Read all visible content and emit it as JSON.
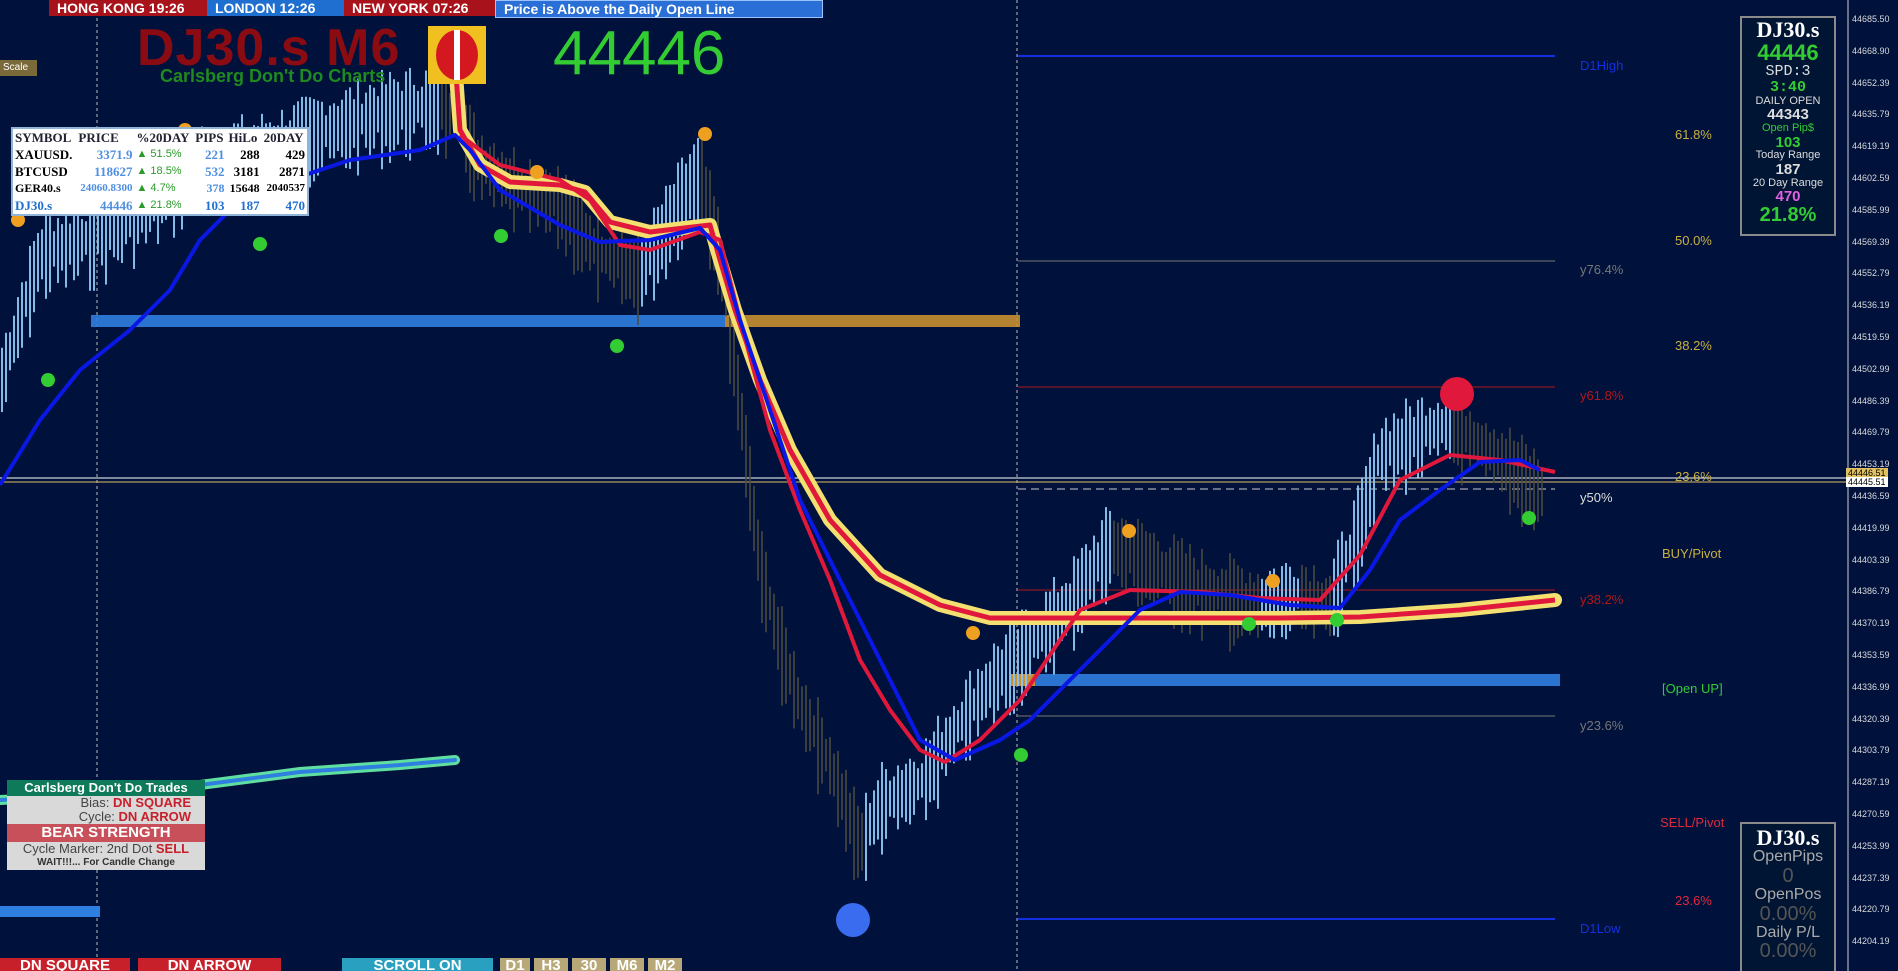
{
  "session_clocks": {
    "hong_kong": "HONG KONG 19:26",
    "london": "LONDON  12:26",
    "new_york": "NEW YORK 07:26"
  },
  "status_message": "Price is Above the Daily Open Line",
  "scale_button": "Scale",
  "header": {
    "title": "DJ30.s M6",
    "subtitle": "Carlsberg Don't Do Charts",
    "price": "44446"
  },
  "symbol_table": {
    "headers": [
      "SYMBOL",
      "PRICE",
      "%20DAY",
      "PIPS",
      "HiLo",
      "20DAY"
    ],
    "rows": [
      {
        "symbol": "XAUUSD.",
        "price": "3371.9",
        "pct": "▲ 51.5%",
        "pips": "221",
        "hilo": "288",
        "day20": "429"
      },
      {
        "symbol": "BTCUSD",
        "price": "118627",
        "pct": "▲ 18.5%",
        "pips": "532",
        "hilo": "3181",
        "day20": "2871"
      },
      {
        "symbol": "GER40.s",
        "price": "24060.8300",
        "pct": "▲ 4.7%",
        "pips": "378",
        "hilo": "15648",
        "day20": "2040537"
      },
      {
        "symbol": "DJ30.s",
        "price": "44446",
        "pct": "▲ 21.8%",
        "pips": "103",
        "hilo": "187",
        "day20": "470"
      }
    ]
  },
  "info_panel": {
    "symbol": "DJ30.s",
    "price": "44446",
    "spread": "SPD:3",
    "timer": "3:40",
    "daily_open_label": "DAILY OPEN",
    "daily_open": "44343",
    "open_pips_label": "Open Pip$",
    "open_pips": "103",
    "today_range_label": "Today Range",
    "today_range": "187",
    "day20_range_label": "20 Day Range",
    "day20_range": "470",
    "pct": "21.8%"
  },
  "positions_panel": {
    "symbol": "DJ30.s",
    "open_pips_label": "OpenPips",
    "open_pips": "0",
    "open_pos_label": "OpenPos",
    "open_pos": "0.00%",
    "daily_pl_label": "Daily P/L",
    "daily_pl": "0.00%"
  },
  "trade_box": {
    "title": "Carlsberg Don't Do Trades",
    "bias_label": "Bias:",
    "bias_value": "DN SQUARE",
    "cycle_label": "Cycle:",
    "cycle_value": "DN ARROW",
    "strength": "BEAR STRENGTH",
    "marker_label": "Cycle Marker: 2nd Dot",
    "marker_value": "SELL",
    "wait": "WAIT!!!... For Candle Change"
  },
  "fib_labels": {
    "d1high": "D1High",
    "y76": "y76.4%",
    "y61": "y61.8%",
    "y50": "y50%",
    "y38": "y38.2%",
    "y23": "y23.6%",
    "d1low": "D1Low",
    "f618": "61.8%",
    "f500": "50.0%",
    "f382": "38.2%",
    "f236": "23.6%",
    "buy_pivot": "BUY/Pivot",
    "open_up": "[Open UP]",
    "sell_pivot": "SELL/Pivot",
    "f236b": "23.6%"
  },
  "price_axis": [
    "44685.50",
    "44668.90",
    "44652.39",
    "44635.79",
    "44619.19",
    "44602.59",
    "44585.99",
    "44569.39",
    "44552.79",
    "44536.19",
    "44519.59",
    "44502.99",
    "44486.39",
    "44469.79",
    "44453.19",
    "44436.59",
    "44419.99",
    "44403.39",
    "44386.79",
    "44370.19",
    "44353.59",
    "44336.99",
    "44320.39",
    "44303.79",
    "44287.19",
    "44270.59",
    "44253.99",
    "44237.39",
    "44220.79",
    "44204.19"
  ],
  "price_tags": {
    "current": "44445.51",
    "open": "44446.51"
  },
  "bottom_buttons": {
    "dn_square": "DN SQUARE",
    "dn_arrow": "DN ARROW",
    "scroll": "SCROLL ON",
    "d1": "D1",
    "h3": "H3",
    "m30": "30",
    "m6": "M6",
    "m2": "M2"
  },
  "colors": {
    "background": "#00113c",
    "bull_candle": "#8cc4f0",
    "bear_candle": "#5a5a4a",
    "ma_blue": "#0a18e6",
    "ma_red": "#e0183c",
    "ma_yellow": "#f0e060",
    "dot_orange": "#f0a020",
    "dot_green": "#33cc33"
  }
}
